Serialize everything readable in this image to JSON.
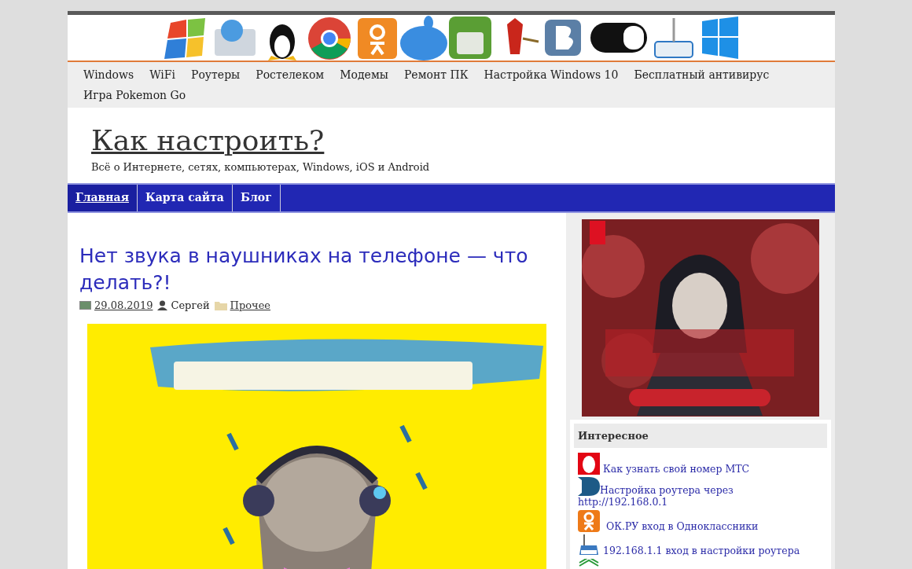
{
  "top_menu": [
    "Windows",
    "WiFi",
    "Роутеры",
    "Ростелеком",
    "Модемы",
    "Ремонт ПК",
    "Настройка Windows 10",
    "Бесплатный антивирус",
    "Игра Pokemon Go"
  ],
  "site": {
    "title": "Как настроить?",
    "tagline": "Всё о Интернете, сетях, компьютерах, Windows, iOS и Android"
  },
  "main_nav": [
    {
      "label": "Главная",
      "selected": true
    },
    {
      "label": "Карта сайта",
      "selected": false
    },
    {
      "label": "Блог",
      "selected": false
    }
  ],
  "article": {
    "title": "Нет звука в наушниках на телефоне — что делать?!",
    "date": "29.08.2019",
    "author": "Сергей",
    "category": "Прочее"
  },
  "sidebar": {
    "widget": {
      "title": "Интересное",
      "items": [
        "Как узнать свой номер МТС",
        "Настройка роутера через http://192.168.0.1",
        "ОК.РУ вход в Одноклассники",
        "192.168.1.1 вход в настройки роутера"
      ]
    }
  }
}
